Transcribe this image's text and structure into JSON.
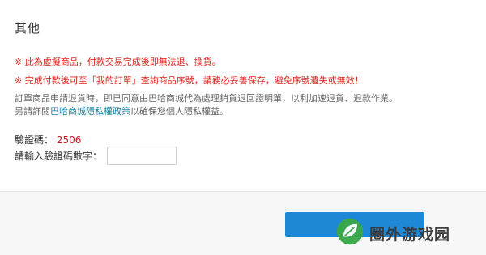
{
  "section": {
    "title": "其他"
  },
  "notices": [
    "※ 此為虛擬商品，付款交易完成後即無法退、換貨。",
    "※ 完成付款後可至「我的訂單」查詢商品序號，請務必妥善保存，避免序號遺失或無效！"
  ],
  "info": {
    "line1": "訂單商品申請退貨時，即已同意由巴哈商城代為處理銷貨退回證明單，以利加速退貨、退款作業。",
    "line2_prefix": "另請詳閱",
    "privacy_link": "巴哈商城隱私權政策",
    "line2_suffix": "以確保您個人隱私權益。"
  },
  "captcha": {
    "label": "驗證碼：",
    "code": "2506",
    "input_label": "請輸入驗證碼數字：",
    "input_value": ""
  },
  "footer": {
    "confirm_label": ""
  },
  "watermark": {
    "text": "圈外游戏园",
    "icon": "leaf-logo-icon"
  },
  "colors": {
    "notice": "#d9231d",
    "link": "#117fa0",
    "button": "#1e88d6",
    "code": "#c8161d",
    "logo": "#3aa84a"
  }
}
